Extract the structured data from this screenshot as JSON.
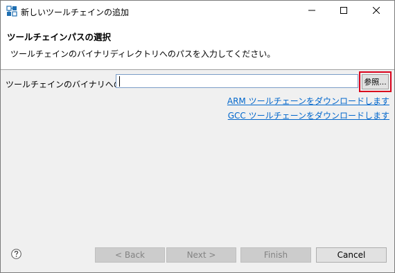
{
  "window": {
    "title": "新しいツールチェインの追加",
    "icon": "toolchain-app-icon",
    "controls": [
      "minimize-icon",
      "maximize-icon",
      "close-icon"
    ]
  },
  "banner": {
    "title": "ツールチェインパスの選択",
    "description": "ツールチェインのバイナリディレクトリへのパスを入力してください。"
  },
  "form": {
    "path_label": "ツールチェインのバイナリへのパス:",
    "path_value": "",
    "browse_label": "参照...",
    "highlight_color": "#d9001b"
  },
  "links": {
    "arm": "ARM ツールチェーンをダウンロードします",
    "gcc": "GCC ツールチェーンをダウンロードします",
    "color": "#0066cc"
  },
  "footer": {
    "help_icon": "help-question-icon",
    "back_label": "< Back",
    "next_label": "Next >",
    "finish_label": "Finish",
    "cancel_label": "Cancel"
  }
}
